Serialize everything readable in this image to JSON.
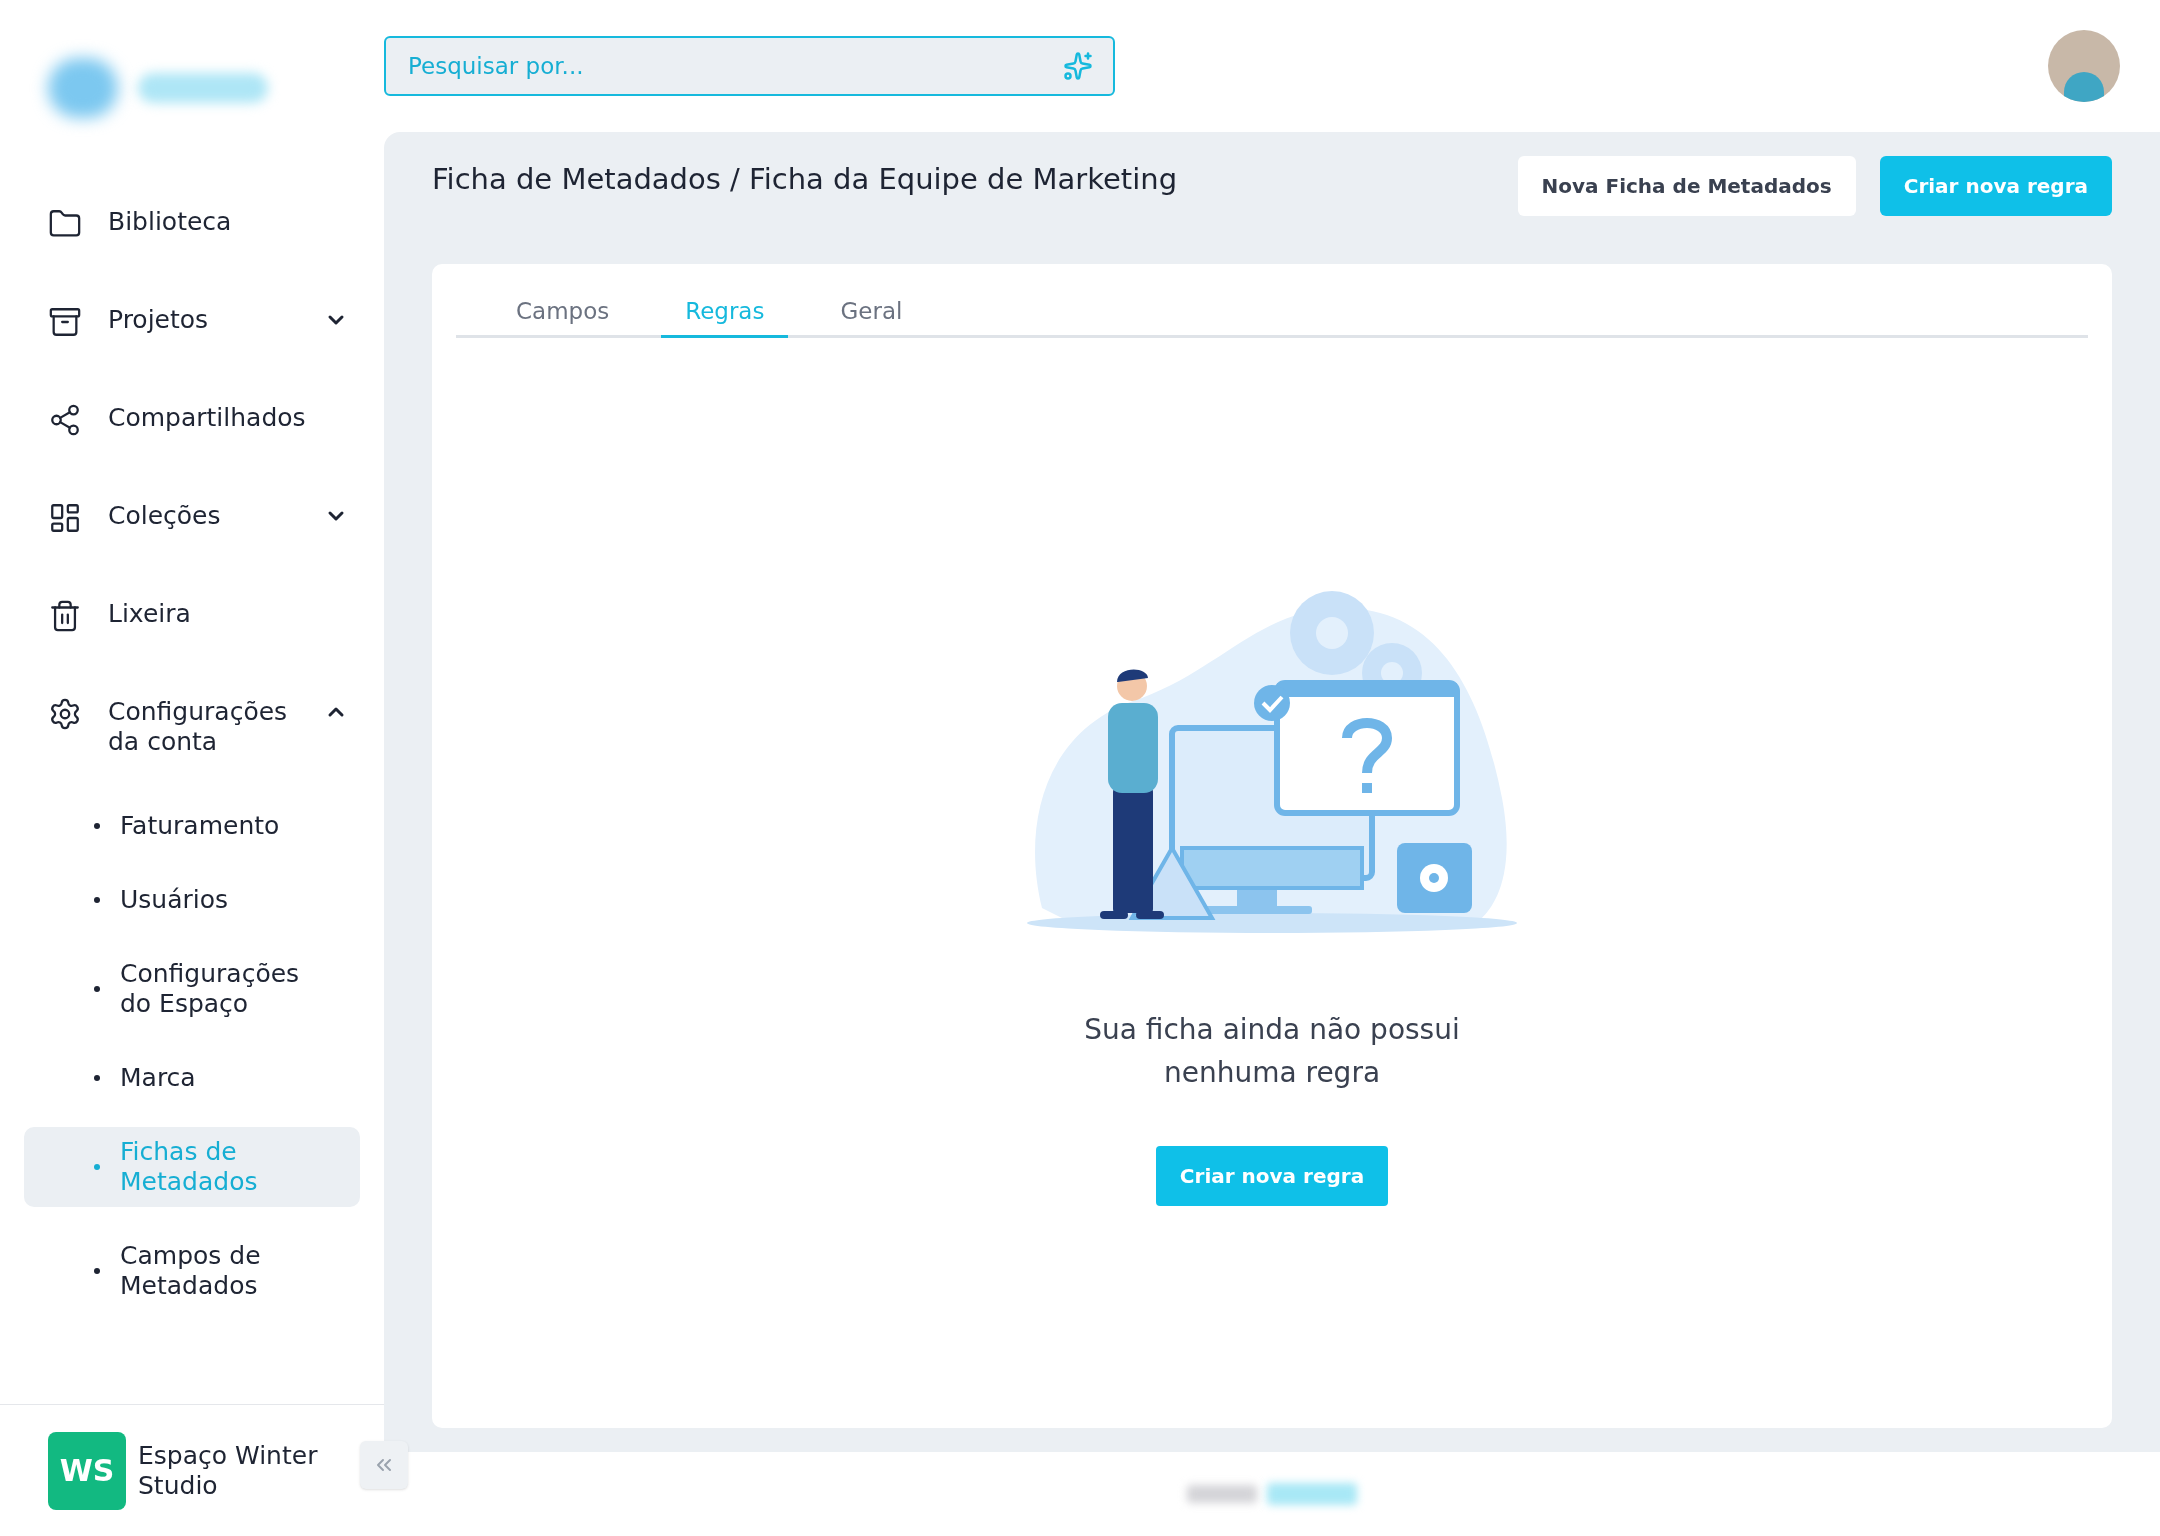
{
  "search": {
    "placeholder": "Pesquisar por..."
  },
  "sidebar": {
    "items": [
      {
        "kind": "folder",
        "label": "Biblioteca"
      },
      {
        "kind": "box",
        "label": "Projetos",
        "expanded": false
      },
      {
        "kind": "share",
        "label": "Compartilhados"
      },
      {
        "kind": "collection",
        "label": "Coleções",
        "expanded": false
      },
      {
        "kind": "trash",
        "label": "Lixeira"
      },
      {
        "kind": "settings",
        "label": "Configurações da conta",
        "expanded": true,
        "children": [
          {
            "label": "Faturamento",
            "selected": false
          },
          {
            "label": "Usuários",
            "selected": false
          },
          {
            "label": "Configurações do Espaço",
            "selected": false
          },
          {
            "label": "Marca",
            "selected": false
          },
          {
            "label": "Fichas de Metadados",
            "selected": true
          },
          {
            "label": "Campos de Metadados",
            "selected": false
          }
        ]
      }
    ],
    "workspace": {
      "initials": "WS",
      "name": "Espaço Winter Studio",
      "color": "#12b981"
    }
  },
  "header": {
    "breadcrumb": "Ficha de Metadados / Ficha da Equipe de Marketing",
    "buttons": [
      {
        "label": "Nova Ficha de Metadados",
        "kind": "secondary"
      },
      {
        "label": "Criar nova regra",
        "kind": "primary"
      }
    ]
  },
  "tabs": [
    {
      "label": "Campos",
      "selected": false
    },
    {
      "label": "Regras",
      "selected": true
    },
    {
      "label": "Geral",
      "selected": false
    }
  ],
  "empty_state": {
    "message": "Sua ficha ainda não possui nenhuma regra",
    "button": "Criar nova regra"
  }
}
